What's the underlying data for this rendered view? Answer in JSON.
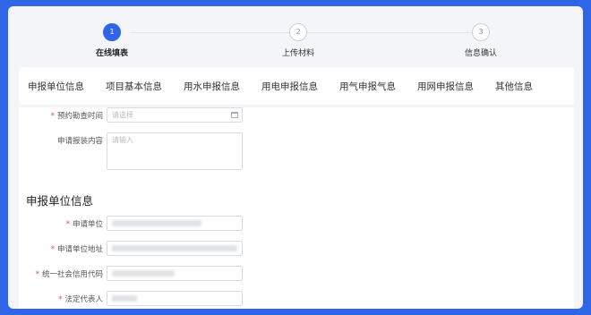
{
  "steps": [
    {
      "num": "1",
      "label": "在线填表",
      "active": true
    },
    {
      "num": "2",
      "label": "上传材料",
      "active": false
    },
    {
      "num": "3",
      "label": "信息确认",
      "active": false
    }
  ],
  "tabs": [
    "申报单位信息",
    "项目基本信息",
    "用水申报信息",
    "用电申报信息",
    "用气申报气息",
    "用网申报信息",
    "其他信息"
  ],
  "form": {
    "survey_time": {
      "label": "预约勘查时间",
      "placeholder": "请选择",
      "required": true
    },
    "install_content": {
      "label": "申请报装内容",
      "placeholder": "请输入",
      "required": false
    },
    "section_title": "申报单位信息",
    "applicant": {
      "label": "申请单位",
      "required": true
    },
    "applicant_address": {
      "label": "申请单位地址",
      "required": true
    },
    "credit_code": {
      "label": "统一社会信用代码",
      "required": true
    },
    "legal_rep": {
      "label": "法定代表人",
      "required": true
    }
  },
  "colors": {
    "accent": "#2f66e8",
    "required": "#e14b4b"
  }
}
